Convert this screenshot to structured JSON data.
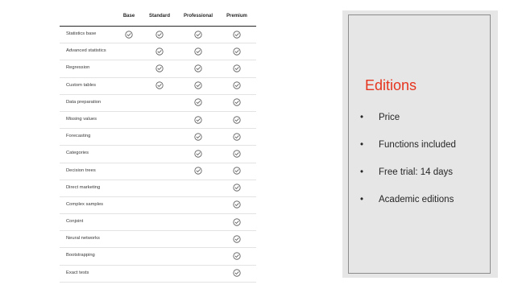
{
  "colors": {
    "title_accent": "#e6351f",
    "panel_background": "#e7e6e6",
    "check_icon": "#555555"
  },
  "table": {
    "columns": [
      "Base",
      "Standard",
      "Professional",
      "Premium"
    ],
    "rows": [
      {
        "label": "Statistics base",
        "checks": [
          true,
          true,
          true,
          true
        ]
      },
      {
        "label": "Advanced statistics",
        "checks": [
          false,
          true,
          true,
          true
        ]
      },
      {
        "label": "Regression",
        "checks": [
          false,
          true,
          true,
          true
        ]
      },
      {
        "label": "Custom tables",
        "checks": [
          false,
          true,
          true,
          true
        ]
      },
      {
        "label": "Data preparation",
        "checks": [
          false,
          false,
          true,
          true
        ]
      },
      {
        "label": "Missing values",
        "checks": [
          false,
          false,
          true,
          true
        ]
      },
      {
        "label": "Forecasting",
        "checks": [
          false,
          false,
          true,
          true
        ]
      },
      {
        "label": "Categories",
        "checks": [
          false,
          false,
          true,
          true
        ]
      },
      {
        "label": "Decision trees",
        "checks": [
          false,
          false,
          true,
          true
        ]
      },
      {
        "label": "Direct marketing",
        "checks": [
          false,
          false,
          false,
          true
        ]
      },
      {
        "label": "Complex samples",
        "checks": [
          false,
          false,
          false,
          true
        ]
      },
      {
        "label": "Conjoint",
        "checks": [
          false,
          false,
          false,
          true
        ]
      },
      {
        "label": "Neural networks",
        "checks": [
          false,
          false,
          false,
          true
        ]
      },
      {
        "label": "Bootstrapping",
        "checks": [
          false,
          false,
          false,
          true
        ]
      },
      {
        "label": "Exact tests",
        "checks": [
          false,
          false,
          false,
          true
        ]
      }
    ]
  },
  "panel": {
    "title": "Editions",
    "bullet_glyph": "•",
    "bullets": [
      "Price",
      "Functions included",
      "Free trial: 14 days",
      "Academic editions"
    ]
  }
}
